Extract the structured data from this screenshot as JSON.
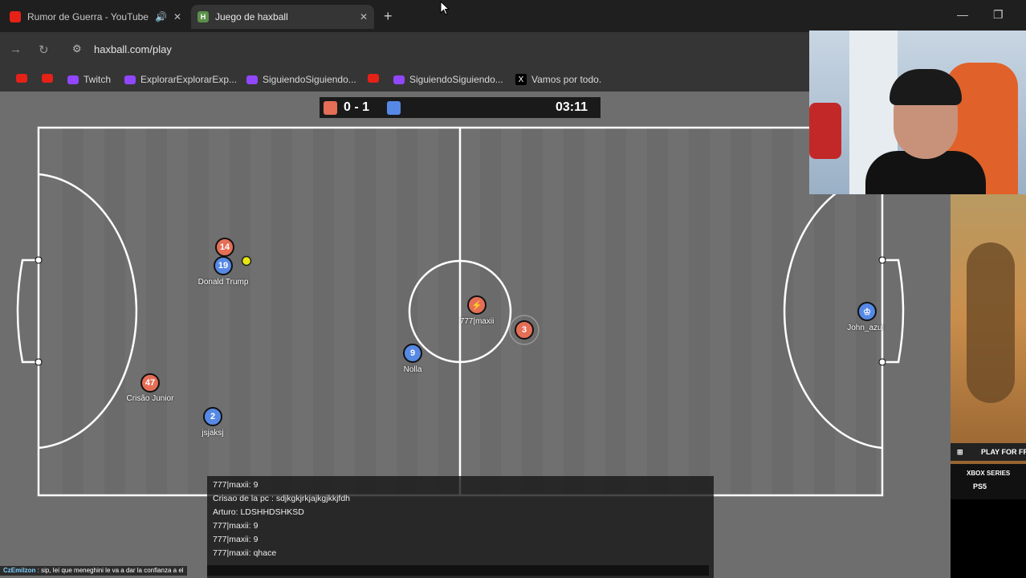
{
  "browser": {
    "tabs": [
      {
        "title": "Rumor de Guerra - YouTube",
        "active": false
      },
      {
        "title": "Juego de haxball",
        "active": true
      }
    ],
    "url": "haxball.com/play",
    "bookmarks": [
      "Twitch",
      "ExplorarExplorarExp...",
      "SiguiendoSiguiendo...",
      "SiguiendoSiguiendo...",
      "Vamos por todo."
    ]
  },
  "scoreboard": {
    "score": "0 - 1",
    "time": "03:11",
    "red_color": "#e56e56",
    "blue_color": "#5689e5"
  },
  "players": [
    {
      "number": "14",
      "team": "red",
      "name": ""
    },
    {
      "number": "19",
      "team": "blue",
      "name": "Donald Trump"
    },
    {
      "number": "47",
      "team": "red",
      "name": "Crisão Junior"
    },
    {
      "number": "2",
      "team": "blue",
      "name": "jsjaksj"
    },
    {
      "number": "9",
      "team": "blue",
      "name": "Nolla"
    },
    {
      "number": "⚡",
      "team": "red",
      "name": "777|maxii"
    },
    {
      "number": "3",
      "team": "red",
      "name": ""
    },
    {
      "number": "♔",
      "team": "blue",
      "name": "John_azul"
    }
  ],
  "chat": [
    {
      "user": "777|maxii",
      "text": "9"
    },
    {
      "user": "Crisao de la pc",
      "text": "sdjkgkjrkjajkgjkkjfdh"
    },
    {
      "user": "Arturo",
      "text": "LDSHHDSHKSD"
    },
    {
      "user": "777|maxii",
      "text": "9"
    },
    {
      "user": "777|maxii",
      "text": "9"
    },
    {
      "user": "777|maxii",
      "text": "qhace"
    }
  ],
  "twitch_chat": {
    "user": "CzEmilzon",
    "text": "sip, leí que meneghini le va a dar la confianza a el"
  },
  "ad": {
    "cta": "PLAY FOR FR",
    "platforms": [
      "XBOX SERIES",
      "PS5"
    ]
  }
}
